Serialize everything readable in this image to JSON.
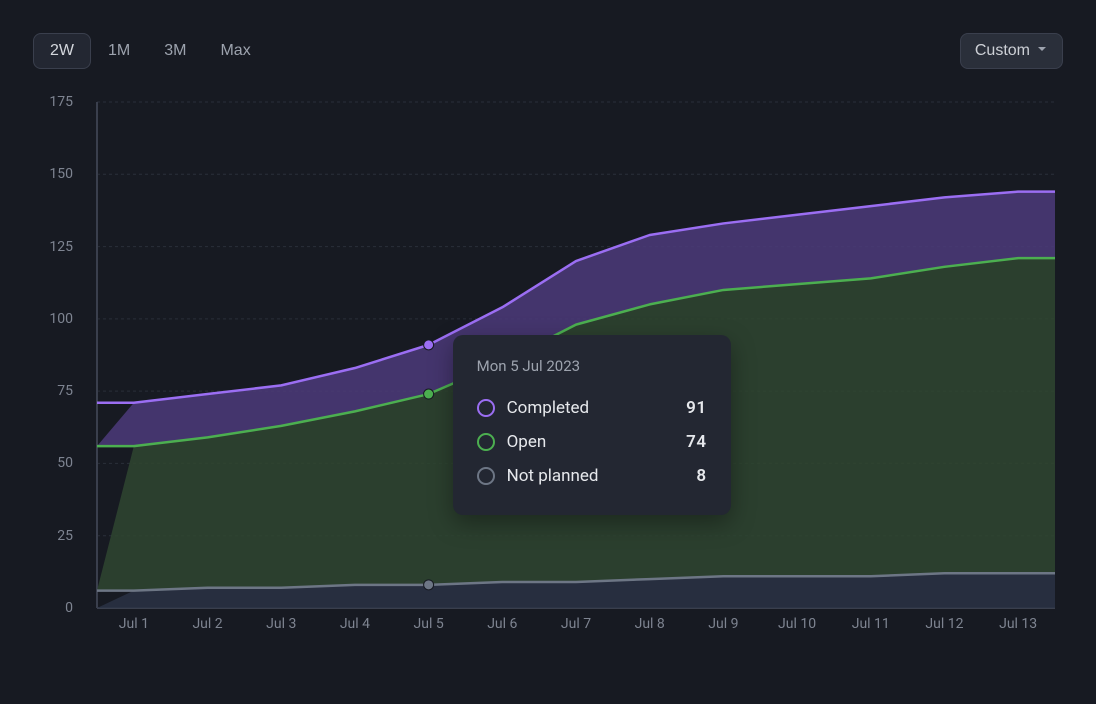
{
  "toolbar": {
    "ranges": [
      "2W",
      "1M",
      "3M",
      "Max"
    ],
    "active_range": "2W",
    "custom_label": "Custom"
  },
  "chart_data": {
    "type": "area",
    "stacked": false,
    "xlabel": "",
    "ylabel": "",
    "ylim": [
      0,
      175
    ],
    "yticks": [
      0,
      25,
      50,
      75,
      100,
      125,
      150,
      175
    ],
    "categories": [
      "Jul 1",
      "Jul 2",
      "Jul 3",
      "Jul 4",
      "Jul 5",
      "Jul 6",
      "Jul 7",
      "Jul 8",
      "Jul 9",
      "Jul 10",
      "Jul 11",
      "Jul 12",
      "Jul 13"
    ],
    "series": [
      {
        "name": "Completed",
        "color": "#9b6ef3",
        "fill": "#4c3b7a",
        "values": [
          71,
          74,
          77,
          83,
          91,
          104,
          120,
          129,
          133,
          136,
          139,
          142,
          144
        ]
      },
      {
        "name": "Open",
        "color": "#4caf50",
        "fill": "#2f4630",
        "values": [
          56,
          59,
          63,
          68,
          74,
          85,
          98,
          105,
          110,
          112,
          114,
          118,
          121
        ]
      },
      {
        "name": "Not planned",
        "color": "#6d7685",
        "fill": "#2a3344",
        "values": [
          6,
          7,
          7,
          8,
          8,
          9,
          9,
          10,
          11,
          11,
          11,
          12,
          12
        ]
      }
    ],
    "hover": {
      "index": 4,
      "date": "Mon 5 Jul 2023",
      "rows": [
        {
          "label": "Completed",
          "value": 91,
          "color": "#9b6ef3"
        },
        {
          "label": "Open",
          "value": 74,
          "color": "#4caf50"
        },
        {
          "label": "Not planned",
          "value": 8,
          "color": "#6d7685"
        }
      ]
    }
  }
}
